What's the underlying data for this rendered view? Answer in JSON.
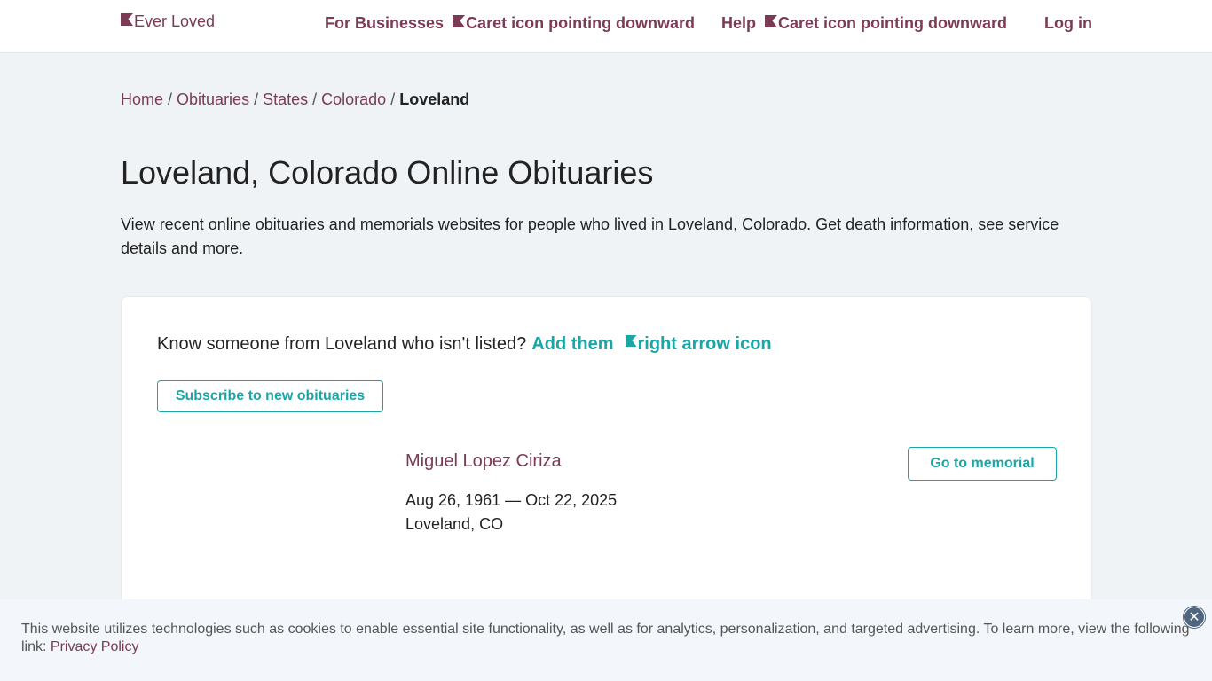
{
  "header": {
    "logo_alt": "Ever Loved",
    "nav": {
      "businesses_label": "For Businesses",
      "businesses_caret_alt": "Caret icon pointing downward",
      "help_label": "Help",
      "help_caret_alt": "Caret icon pointing downward",
      "login_label": "Log in"
    }
  },
  "breadcrumb": {
    "items": [
      "Home",
      "Obituaries",
      "States",
      "Colorado"
    ],
    "separator": "/",
    "current": "Loveland"
  },
  "page": {
    "title": "Loveland, Colorado Online Obituaries",
    "intro": "View recent online obituaries and memorials websites for people who lived in Loveland, Colorado. Get death information, see service details and more."
  },
  "listing": {
    "prompt": "Know someone from Loveland who isn't listed?",
    "add_label": "Add them",
    "arrow_alt": "right arrow icon",
    "subscribe_label": "Subscribe to new obituaries",
    "memorials": [
      {
        "name": "Miguel Lopez Ciriza",
        "dates": "Aug 26, 1961 — Oct 22, 2025",
        "location": "Loveland, CO",
        "button_label": "Go to memorial"
      }
    ]
  },
  "cookie_banner": {
    "text": "This website utilizes technologies such as cookies to enable essential site functionality, as well as for analytics, personalization, and targeted advertising. To learn more, view the following link:",
    "link_label": "Privacy Policy",
    "close_glyph": "✕"
  },
  "colors": {
    "brand": "#7a3b55",
    "accent": "#1aa6a6",
    "background": "#f0f3f6"
  }
}
